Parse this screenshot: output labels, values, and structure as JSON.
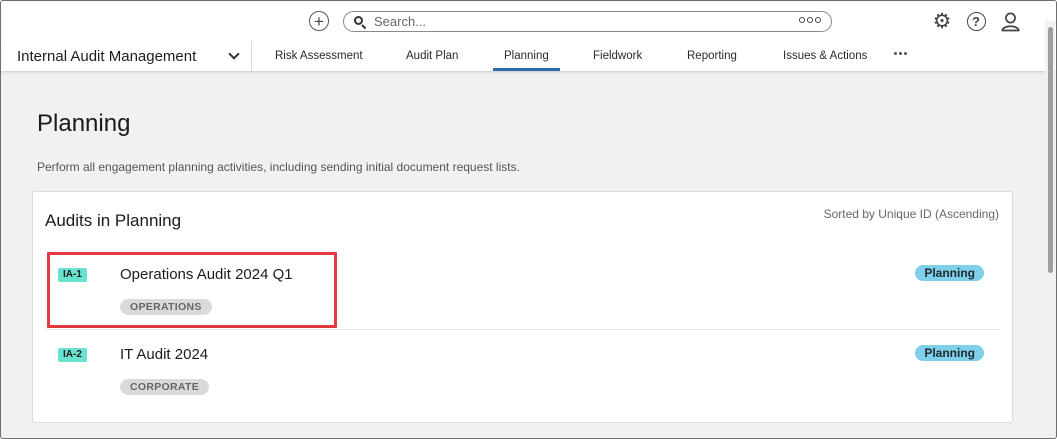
{
  "topbar": {
    "search_placeholder": "Search...",
    "icons": [
      "add-icon",
      "search-icon",
      "more-options-icon",
      "gear-icon",
      "help-icon",
      "user-icon"
    ]
  },
  "nav": {
    "app_name": "Internal Audit Management",
    "tabs": [
      {
        "label": "Risk Assessment"
      },
      {
        "label": "Audit Plan"
      },
      {
        "label": "Planning",
        "active": true
      },
      {
        "label": "Fieldwork"
      },
      {
        "label": "Reporting"
      },
      {
        "label": "Issues & Actions"
      }
    ]
  },
  "page": {
    "title": "Planning",
    "description": "Perform all engagement planning activities, including sending initial document request lists."
  },
  "card": {
    "title": "Audits in Planning",
    "sort_note": "Sorted by Unique ID (Ascending)",
    "rows": [
      {
        "id": "IA-1",
        "title": "Operations Audit 2024 Q1",
        "tag": "OPERATIONS",
        "status": "Planning"
      },
      {
        "id": "IA-2",
        "title": "IT Audit 2024",
        "tag": "CORPORATE",
        "status": "Planning"
      }
    ]
  },
  "colors": {
    "accent": "#2d6ab1",
    "id_badge": "#69e3cf",
    "status_badge": "#7ecfe7",
    "highlight": "#e0393f"
  }
}
